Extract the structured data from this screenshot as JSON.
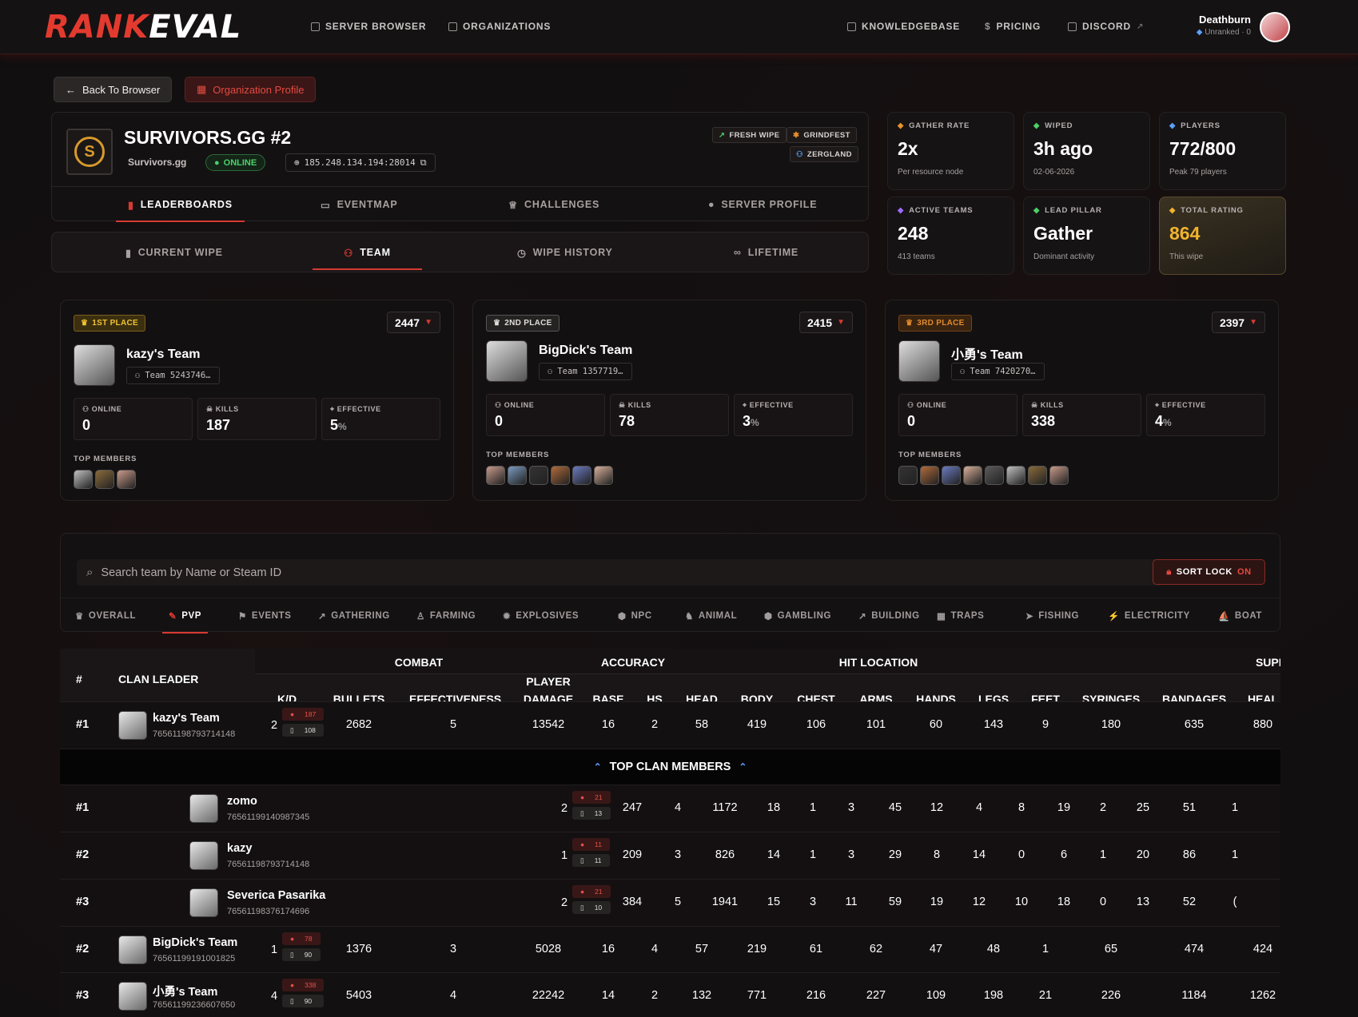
{
  "header": {
    "logo_a": "RANK",
    "logo_b": "EVAL",
    "nav": [
      "SERVER BROWSER",
      "ORGANIZATIONS",
      "KNOWLEDGEBASE",
      "PRICING",
      "DISCORD"
    ],
    "user_name": "Deathburn",
    "user_status": "Unranked · 0"
  },
  "actions": {
    "back": "Back To Browser",
    "org": "Organization Profile"
  },
  "server": {
    "title": "SURVIVORS.GG #2",
    "org": "Survivors.gg",
    "status": "ONLINE",
    "ip": "185.248.134.194:28014",
    "tags": [
      "FRESH WIPE",
      "GRINDFEST",
      "ZERGLAND"
    ],
    "tabs": [
      "LEADERBOARDS",
      "EVENTMAP",
      "CHALLENGES",
      "SERVER PROFILE"
    ],
    "subtabs": [
      "CURRENT WIPE",
      "TEAM",
      "WIPE HISTORY",
      "LIFETIME"
    ]
  },
  "stats": [
    {
      "label": "GATHER RATE",
      "value": "2x",
      "desc": "Per resource node",
      "color": "#e8912d"
    },
    {
      "label": "WIPED",
      "value": "3h ago",
      "desc": "02-06-2026",
      "color": "#4bd16a"
    },
    {
      "label": "PLAYERS",
      "value": "772/800",
      "desc": "Peak 79 players",
      "color": "#5aa0ff"
    },
    {
      "label": "ACTIVE TEAMS",
      "value": "248",
      "desc": "413 teams",
      "color": "#9a6bff"
    },
    {
      "label": "LEAD PILLAR",
      "value": "Gather",
      "desc": "Dominant activity",
      "color": "#4bd16a"
    },
    {
      "label": "TOTAL RATING",
      "value": "864",
      "desc": "This wipe",
      "color": "#f1b22d"
    }
  ],
  "podium": [
    {
      "place": "1ST PLACE",
      "rating": "2447",
      "name": "kazy's Team",
      "team_id": "Team 5243746…",
      "online": "0",
      "kills": "187",
      "effective": "5",
      "members": 3
    },
    {
      "place": "2ND PLACE",
      "rating": "2415",
      "name": "BigDick's Team",
      "team_id": "Team 1357719…",
      "online": "0",
      "kills": "78",
      "effective": "3",
      "members": 6
    },
    {
      "place": "3RD PLACE",
      "rating": "2397",
      "name": "小勇's Team",
      "team_id": "Team 7420270…",
      "online": "0",
      "kills": "338",
      "effective": "4",
      "members": 8
    }
  ],
  "labels": {
    "online": "ONLINE",
    "kills": "KILLS",
    "effective": "EFFECTIVE",
    "top_members": "TOP MEMBERS",
    "pct": "%"
  },
  "search": {
    "placeholder": "Search team by Name or Steam ID",
    "sort_lock": "SORT LOCK",
    "sort_state": "ON"
  },
  "categories": [
    "OVERALL",
    "PVP",
    "EVENTS",
    "GATHERING",
    "FARMING",
    "EXPLOSIVES",
    "NPC",
    "ANIMAL",
    "GAMBLING",
    "BUILDING",
    "TRAPS",
    "FISHING",
    "ELECTRICITY",
    "BOAT"
  ],
  "table": {
    "groups": [
      "COMBAT",
      "ACCURACY",
      "HIT LOCATION",
      "SUPP"
    ],
    "rank_col": "#",
    "leader_col": "CLAN LEADER",
    "columns": [
      "K/D",
      "BULLETS",
      "EFFECTIVENESS",
      "PLAYER DAMAGE",
      "BASE",
      "HS",
      "HEAD",
      "BODY",
      "CHEST",
      "ARMS",
      "HANDS",
      "LEGS",
      "FEET",
      "SYRINGES",
      "BANDAGES",
      "HEAL"
    ],
    "divider": "TOP CLAN MEMBERS",
    "clans": [
      {
        "rank": "#1",
        "name": "kazy's Team",
        "steam": "76561198793714148",
        "kd": "2",
        "k": "187",
        "d": "108",
        "vals": [
          "2682",
          "5",
          "13542",
          "16",
          "2",
          "58",
          "419",
          "106",
          "101",
          "60",
          "143",
          "9",
          "180",
          "635",
          "880"
        ]
      },
      {
        "rank": "#2",
        "name": "BigDick's Team",
        "steam": "76561199191001825",
        "kd": "1",
        "k": "78",
        "d": "90",
        "vals": [
          "1376",
          "3",
          "5028",
          "16",
          "4",
          "57",
          "219",
          "61",
          "62",
          "47",
          "48",
          "1",
          "65",
          "474",
          "424"
        ]
      },
      {
        "rank": "#3",
        "name": "小勇's Team",
        "steam": "76561199236607650",
        "kd": "4",
        "k": "338",
        "d": "90",
        "vals": [
          "5403",
          "4",
          "22242",
          "14",
          "2",
          "132",
          "771",
          "216",
          "227",
          "109",
          "198",
          "21",
          "226",
          "1184",
          "1262"
        ]
      }
    ],
    "members": [
      {
        "rank": "#1",
        "name": "zomo",
        "steam": "76561199140987345",
        "kd": "2",
        "k": "21",
        "d": "13",
        "vals": [
          "247",
          "4",
          "1172",
          "18",
          "1",
          "3",
          "45",
          "12",
          "4",
          "8",
          "19",
          "2",
          "25",
          "51",
          "1"
        ]
      },
      {
        "rank": "#2",
        "name": "kazy",
        "steam": "76561198793714148",
        "kd": "1",
        "k": "11",
        "d": "11",
        "vals": [
          "209",
          "3",
          "826",
          "14",
          "1",
          "3",
          "29",
          "8",
          "14",
          "0",
          "6",
          "1",
          "20",
          "86",
          "1"
        ]
      },
      {
        "rank": "#3",
        "name": "Severica Pasarika",
        "steam": "76561198376174696",
        "kd": "2",
        "k": "21",
        "d": "10",
        "vals": [
          "384",
          "5",
          "1941",
          "15",
          "3",
          "11",
          "59",
          "19",
          "12",
          "10",
          "18",
          "0",
          "13",
          "52",
          "("
        ]
      }
    ]
  }
}
